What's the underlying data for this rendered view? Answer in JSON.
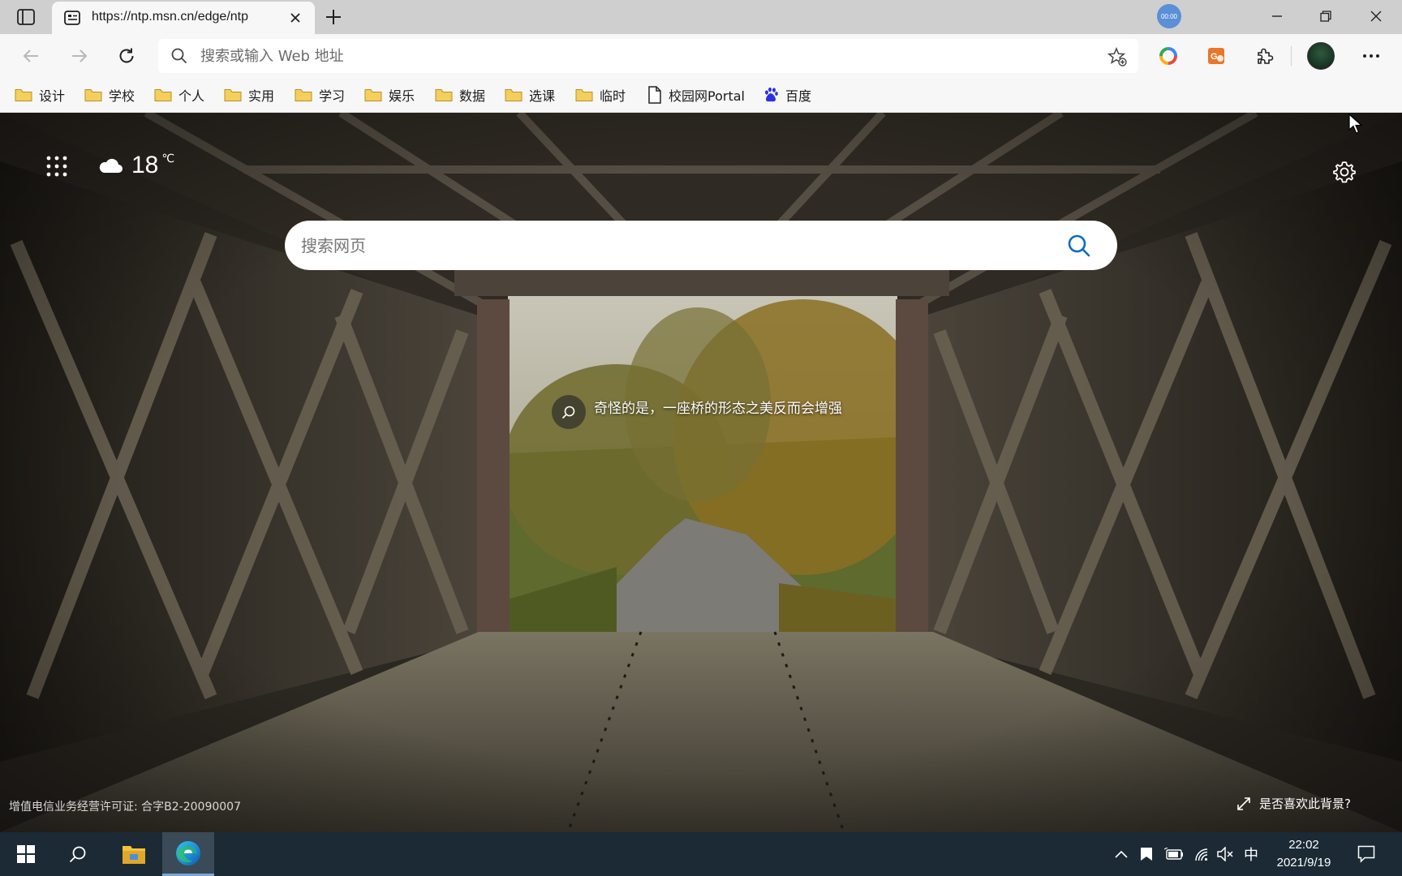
{
  "browser": {
    "tab": {
      "title": "https://ntp.msn.cn/edge/ntp"
    },
    "timer_badge": "00:00",
    "address": {
      "placeholder": "搜索或输入 Web 地址",
      "value": ""
    }
  },
  "favorites": [
    {
      "label": "设计",
      "type": "folder"
    },
    {
      "label": "学校",
      "type": "folder"
    },
    {
      "label": "个人",
      "type": "folder"
    },
    {
      "label": "实用",
      "type": "folder"
    },
    {
      "label": "学习",
      "type": "folder"
    },
    {
      "label": "娱乐",
      "type": "folder"
    },
    {
      "label": "数据",
      "type": "folder"
    },
    {
      "label": "选课",
      "type": "folder"
    },
    {
      "label": "临时",
      "type": "folder"
    },
    {
      "label": "校园网Portal",
      "type": "page"
    },
    {
      "label": "百度",
      "type": "site"
    }
  ],
  "ntp": {
    "weather": {
      "temperature": "18",
      "unit": "℃",
      "icon": "cloud-icon"
    },
    "search": {
      "placeholder": "搜索网页",
      "value": ""
    },
    "image_caption": "奇怪的是，一座桥的形态之美反而会增强",
    "license": "增值电信业务经营许可证: 合字B2-20090007",
    "like_background": "是否喜欢此背景?"
  },
  "taskbar": {
    "ime": "中",
    "time": "22:02",
    "date": "2021/9/19"
  },
  "colors": {
    "tabbar": "#cfcfcf",
    "toolbar": "#f7f7f7",
    "taskbar": "#1b2a35",
    "folder": "#f2c94c",
    "edge_blue": "#1e88d3"
  }
}
